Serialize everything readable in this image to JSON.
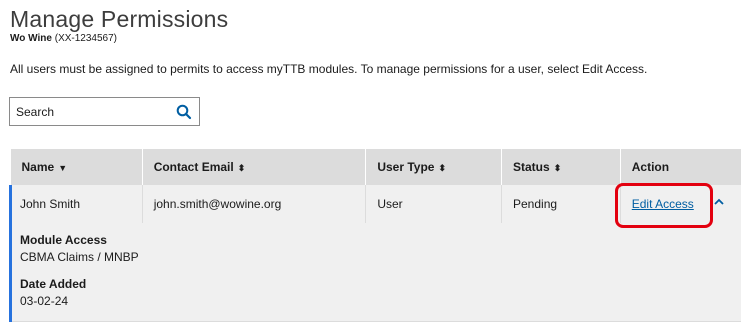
{
  "page": {
    "title": "Manage Permissions",
    "org_name": "Wo Wine",
    "org_id": "(XX-1234567)",
    "intro": "All users must be assigned to permits to access myTTB modules. To manage permissions for a user, select Edit Access."
  },
  "search": {
    "placeholder": "Search",
    "value": "",
    "icon": "search-icon"
  },
  "table": {
    "columns": [
      {
        "label": "Name",
        "sort": "▼"
      },
      {
        "label": "Contact Email",
        "sort": "⬍"
      },
      {
        "label": "User Type",
        "sort": "⬍"
      },
      {
        "label": "Status",
        "sort": "⬍"
      },
      {
        "label": "Action",
        "sort": ""
      }
    ],
    "rows": [
      {
        "name": "John Smith",
        "email": "john.smith@wowine.org",
        "user_type": "User",
        "status": "Pending",
        "action_label": "Edit Access",
        "expanded": true,
        "details": {
          "module_access_label": "Module Access",
          "module_access_value": "CBMA Claims / MNBP",
          "date_added_label": "Date Added",
          "date_added_value": "03-02-24"
        }
      }
    ]
  },
  "colors": {
    "accent": "#2672de",
    "link": "#005ea2",
    "highlight": "#e3000f",
    "header_bg": "#dcdcdc",
    "row_bg": "#f0f0f0"
  }
}
